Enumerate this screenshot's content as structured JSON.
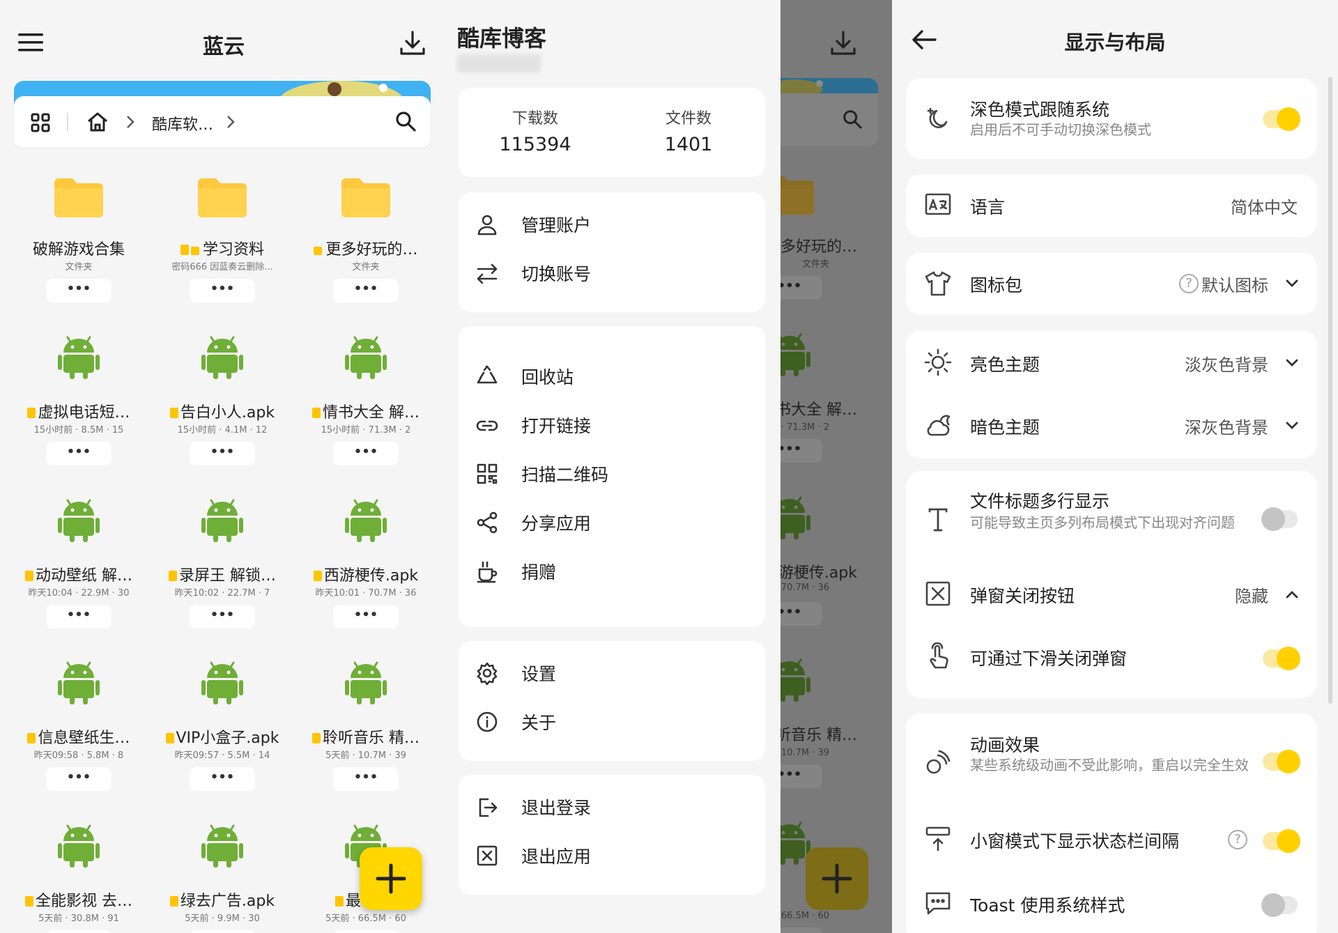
{
  "main": {
    "title": "蓝云",
    "breadcrumb": {
      "folder": "酷库软…"
    },
    "files": [
      {
        "name": "破解游戏合集",
        "sub": "文件夹",
        "kind": "folder",
        "tag": false,
        "lock": false
      },
      {
        "name": "学习资料",
        "sub": "密码666 因蓝奏云删除...",
        "kind": "folder",
        "tag": true,
        "lock": true
      },
      {
        "name": "更多好玩的…",
        "sub": "文件夹",
        "kind": "folder",
        "tag": false,
        "lock": true
      },
      {
        "name": "虚拟电话短…",
        "sub": "15小时前 · 8.5M · 15",
        "kind": "apk",
        "tag": true,
        "lock": false
      },
      {
        "name": "告白小人.apk",
        "sub": "15小时前 · 4.1M · 12",
        "kind": "apk",
        "tag": true,
        "lock": false
      },
      {
        "name": "情书大全 解…",
        "sub": "15小时前 · 71.3M · 2",
        "kind": "apk",
        "tag": true,
        "lock": false
      },
      {
        "name": "动动壁纸 解…",
        "sub": "昨天10:04 · 22.9M · 30",
        "kind": "apk",
        "tag": true,
        "lock": false
      },
      {
        "name": "录屏王 解锁…",
        "sub": "昨天10:02 · 22.7M · 7",
        "kind": "apk",
        "tag": true,
        "lock": false
      },
      {
        "name": "西游梗传.apk",
        "sub": "昨天10:01 · 70.7M · 36",
        "kind": "apk",
        "tag": true,
        "lock": false
      },
      {
        "name": "信息壁纸生…",
        "sub": "昨天09:58 · 5.8M · 8",
        "kind": "apk",
        "tag": true,
        "lock": false
      },
      {
        "name": "VIP小盒子.apk",
        "sub": "昨天09:57 · 5.5M · 14",
        "kind": "apk",
        "tag": true,
        "lock": false
      },
      {
        "name": "聆听音乐 精…",
        "sub": "5天前 · 10.7M · 39",
        "kind": "apk",
        "tag": true,
        "lock": false
      },
      {
        "name": "全能影视 去…",
        "sub": "5天前 · 30.8M · 91",
        "kind": "apk",
        "tag": true,
        "lock": false
      },
      {
        "name": "绿去广告.apk",
        "sub": "5天前 · 9.9M · 30",
        "kind": "apk",
        "tag": true,
        "lock": false
      },
      {
        "name": "最右 …",
        "sub": "5天前 · 66.5M · 60",
        "kind": "apk",
        "tag": true,
        "lock": false
      }
    ],
    "more_label": "•••",
    "fab_label": "+"
  },
  "drawer": {
    "username": "酷库博客",
    "stats": {
      "downloads_label": "下载数",
      "downloads": "115394",
      "files_label": "文件数",
      "files": "1401"
    },
    "items": [
      {
        "label": "管理账户",
        "icon": "person-icon"
      },
      {
        "label": "切换账号",
        "icon": "swap-icon"
      },
      {
        "label": "回收站",
        "icon": "recycle-icon"
      },
      {
        "label": "打开链接",
        "icon": "link-icon"
      },
      {
        "label": "扫描二维码",
        "icon": "qr-icon"
      },
      {
        "label": "分享应用",
        "icon": "share-icon"
      },
      {
        "label": "捐赠",
        "icon": "coffee-icon"
      },
      {
        "label": "设置",
        "icon": "gear-icon"
      },
      {
        "label": "关于",
        "icon": "info-icon"
      },
      {
        "label": "退出登录",
        "icon": "logout-icon"
      },
      {
        "label": "退出应用",
        "icon": "close-box-icon"
      }
    ]
  },
  "dim": {
    "files": [
      {
        "name": "更多好玩的…",
        "sub": "文件夹"
      },
      {
        "name": "情书大全 解…",
        "sub": "小时前 · 71.3M · 2"
      },
      {
        "name": "西游梗传.apk",
        "sub": "10:01 · 70.7M · 36"
      },
      {
        "name": "聆听音乐 精…",
        "sub": "天前 · 10.7M · 39"
      },
      {
        "name": "右 …",
        "sub": "天前 · 66.5M · 60"
      }
    ]
  },
  "settings": {
    "title": "显示与布局",
    "dark_follow": {
      "title": "深色模式跟随系统",
      "desc": "启用后不可手动切换深色模式",
      "on": true
    },
    "language": {
      "title": "语言",
      "value": "简体中文"
    },
    "icon_pack": {
      "title": "图标包",
      "value": "默认图标",
      "help": "?"
    },
    "light_theme": {
      "title": "亮色主题",
      "value": "淡灰色背景"
    },
    "dark_theme": {
      "title": "暗色主题",
      "value": "深灰色背景"
    },
    "multiline": {
      "title": "文件标题多行显示",
      "desc": "可能导致主页多列布局模式下出现对齐问题",
      "on": false
    },
    "close_btn": {
      "title": "弹窗关闭按钮",
      "value": "隐藏"
    },
    "swipe_close": {
      "title": "可通过下滑关闭弹窗",
      "on": true
    },
    "animation": {
      "title": "动画效果",
      "desc": "某些系统级动画不受此影响，重启以完全生效",
      "on": true
    },
    "status_gap": {
      "title": "小窗模式下显示状态栏间隔",
      "help": "?",
      "on": true
    },
    "toast": {
      "title": "Toast 使用系统样式",
      "on": false
    }
  },
  "colors": {
    "accent": "#ffd600",
    "android": "#6fae37",
    "folder": "#ffc83d",
    "banner": "#40b1f2"
  }
}
